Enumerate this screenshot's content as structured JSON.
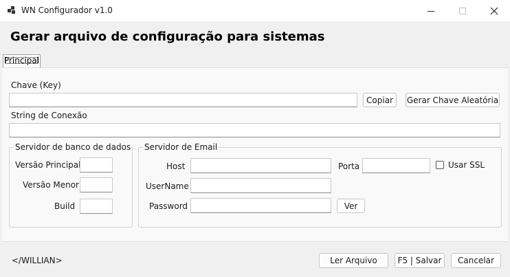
{
  "window": {
    "title": "WN Configurador v1.0",
    "minimize_glyph": "—",
    "maximize_glyph": "☐",
    "close_glyph": "✕"
  },
  "heading": "Gerar arquivo de configuração para sistemas",
  "tabs": [
    {
      "label": "Principal"
    }
  ],
  "key_section": {
    "label": "Chave (Key)",
    "value": "",
    "copy_button": "Copiar",
    "generate_button": "Gerar Chave Aleatória"
  },
  "connection": {
    "label": "String de Conexão",
    "value": ""
  },
  "db_server": {
    "legend": "Servidor de banco de dados",
    "major_label": "Versão Principal",
    "minor_label": "Versão Menor",
    "build_label": "Build",
    "major_value": "",
    "minor_value": "",
    "build_value": ""
  },
  "email_server": {
    "legend": "Servidor de Email",
    "host_label": "Host",
    "port_label": "Porta",
    "ssl_label": "Usar SSL",
    "user_label": "UserName",
    "password_label": "Password",
    "show_button": "Ver",
    "ssl_checked": false
  },
  "footer": {
    "author": "</WILLIAN>",
    "read_button": "Ler Arquivo",
    "save_button": "F5 | Salvar",
    "cancel_button": "Cancelar"
  }
}
